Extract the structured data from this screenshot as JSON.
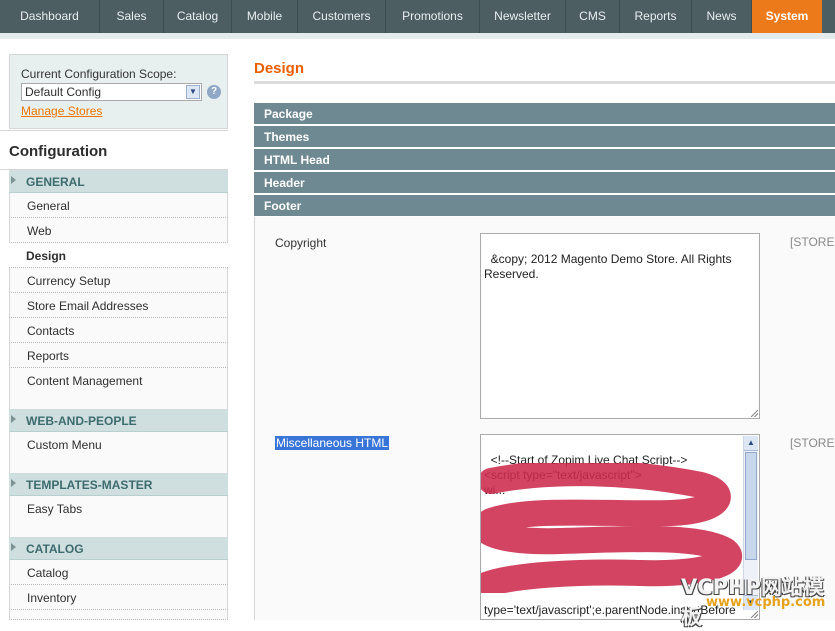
{
  "nav": {
    "items": [
      "Dashboard",
      "Sales",
      "Catalog",
      "Mobile",
      "Customers",
      "Promotions",
      "Newsletter",
      "CMS",
      "Reports",
      "News",
      "System"
    ],
    "active": "System"
  },
  "sidebar": {
    "scope_label": "Current Configuration Scope:",
    "scope_value": "Default Config",
    "manage_stores": "Manage Stores",
    "config_title": "Configuration",
    "groups": [
      {
        "title": "GENERAL",
        "items": [
          "General",
          "Web",
          "Design",
          "Currency Setup",
          "Store Email Addresses",
          "Contacts",
          "Reports",
          "Content Management"
        ]
      },
      {
        "title": "WEB-AND-PEOPLE",
        "items": [
          "Custom Menu"
        ]
      },
      {
        "title": "TEMPLATES-MASTER",
        "items": [
          "Easy Tabs"
        ]
      },
      {
        "title": "CATALOG",
        "items": [
          "Catalog",
          "Inventory"
        ]
      }
    ],
    "active_item": "Design"
  },
  "main": {
    "title": "Design",
    "sections": [
      "Package",
      "Themes",
      "HTML Head",
      "Header",
      "Footer"
    ],
    "fields": [
      {
        "label": "Copyright",
        "value": "&copy; 2012 Magento Demo Store. All Rights Reserved.",
        "scope": "[STORE"
      },
      {
        "label": "Miscellaneous HTML",
        "value": "<!--Start of Zopim Live Chat Script-->\n<script type=\"text/javascript\">\nwi...\n\n\n\n\n\n\n\ntype='text/javascript';e.parentNode.insertBefore",
        "scope": "[STORE"
      }
    ]
  },
  "watermark": {
    "line1": "VCPHP网站模板",
    "line2": "www.vcphp.com"
  },
  "colors": {
    "nav_bg": "#4d5e63",
    "active_tab": "#ec7a1a",
    "section_bar": "#6f8992",
    "title_orange": "#eb5e00",
    "link_orange": "#ea7601"
  }
}
